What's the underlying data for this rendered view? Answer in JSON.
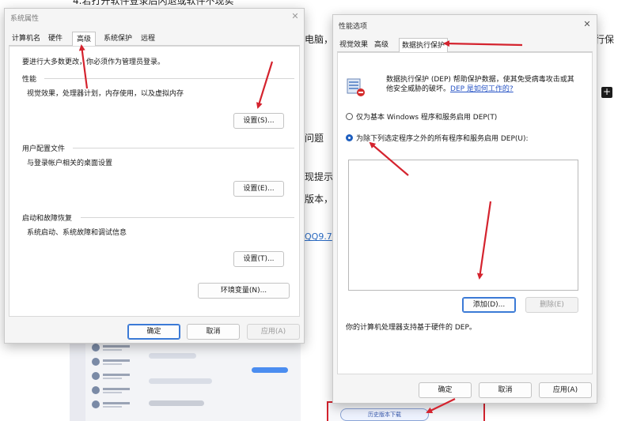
{
  "background": {
    "heading_partial": "4.若打开软件登录后闪退或软件不现实",
    "fragments": [
      "电脑，",
      "行保",
      "问题",
      "现提示",
      "版本，",
      "QQ9.7"
    ],
    "plus_glyph": "+",
    "download_button": "历史版本下载"
  },
  "system_properties": {
    "title": "系统属性",
    "close_glyph": "✕",
    "tabs": [
      "计算机名",
      "硬件",
      "高级",
      "系统保护",
      "远程"
    ],
    "active_tab": "高级",
    "admin_note": "要进行大多数更改，你必须作为管理员登录。",
    "performance": {
      "label": "性能",
      "description": "视觉效果，处理器计划，内存使用，以及虚拟内存",
      "settings_button": "设置(S)..."
    },
    "user_profiles": {
      "label": "用户配置文件",
      "description": "与登录帐户相关的桌面设置",
      "settings_button": "设置(E)..."
    },
    "startup_recovery": {
      "label": "启动和故障恢复",
      "description": "系统启动、系统故障和调试信息",
      "settings_button": "设置(T)..."
    },
    "env_vars_button": "环境变量(N)...",
    "footer": {
      "ok": "确定",
      "cancel": "取消",
      "apply": "应用(A)"
    }
  },
  "performance_options": {
    "title": "性能选项",
    "close_glyph": "✕",
    "tabs": [
      "视觉效果",
      "高级",
      "数据执行保护"
    ],
    "active_tab": "数据执行保护",
    "dep_description_line1": "数据执行保护 (DEP) 帮助保护数据，使其免受病毒攻击或其",
    "dep_description_line2": "他安全威胁的破坏。",
    "dep_help_link": "DEP 是如何工作的?",
    "option_essential": "仅为基本 Windows 程序和服务启用 DEP(T)",
    "option_all_except": "为除下列选定程序之外的所有程序和服务启用 DEP(U):",
    "selected_option": "option_all_except",
    "exception_list": [],
    "add_button": "添加(D)...",
    "remove_button": "删除(E)",
    "hardware_note": "你的计算机处理器支持基于硬件的 DEP。",
    "footer": {
      "ok": "确定",
      "cancel": "取消",
      "apply": "应用(A)"
    }
  },
  "colors": {
    "annotation_arrow": "#d4232e",
    "accent": "#1f5fbf",
    "link": "#2a56c6"
  },
  "icons": [
    "close-icon",
    "shield-dep-icon",
    "radio-icon"
  ]
}
